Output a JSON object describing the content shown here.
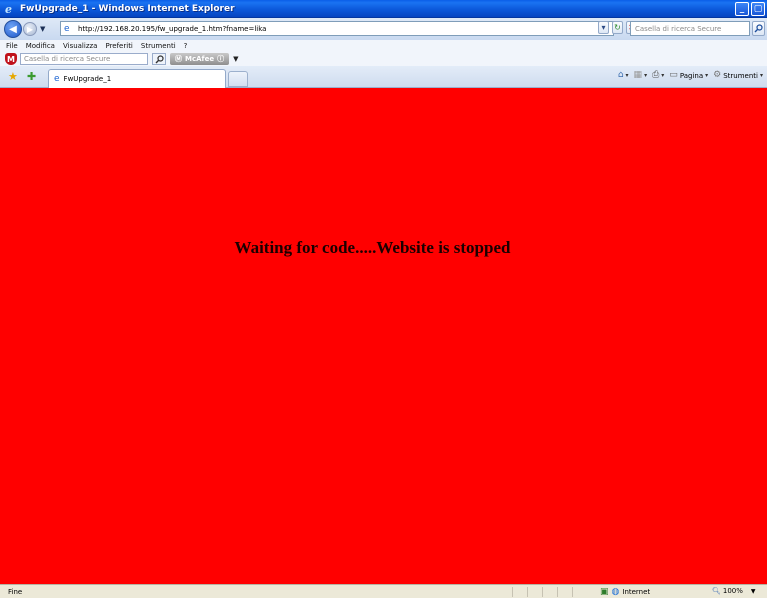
{
  "window": {
    "title": "FwUpgrade_1 - Windows Internet Explorer",
    "minimize_label": "_",
    "maximize_label": "▢"
  },
  "address_bar": {
    "url": "http://192.168.20.195/fw_upgrade_1.htm?fname=lika",
    "search_placeholder": "Casella di ricerca Secure"
  },
  "menu": {
    "items": [
      "File",
      "Modifica",
      "Visualizza",
      "Preferiti",
      "Strumenti",
      "?"
    ]
  },
  "mcafee_toolbar": {
    "search_placeholder": "Casella di ricerca Secure",
    "brand_label": "McAfee"
  },
  "tabs": [
    {
      "label": "FwUpgrade_1"
    }
  ],
  "command_bar": {
    "page_label": "Pagina",
    "tools_label": "Strumenti"
  },
  "page": {
    "message": "Waiting for code.....Website is stopped",
    "background_color": "#ff0000"
  },
  "status_bar": {
    "status_text": "Fine",
    "zone_label": "Internet",
    "zoom_label": "100%"
  }
}
